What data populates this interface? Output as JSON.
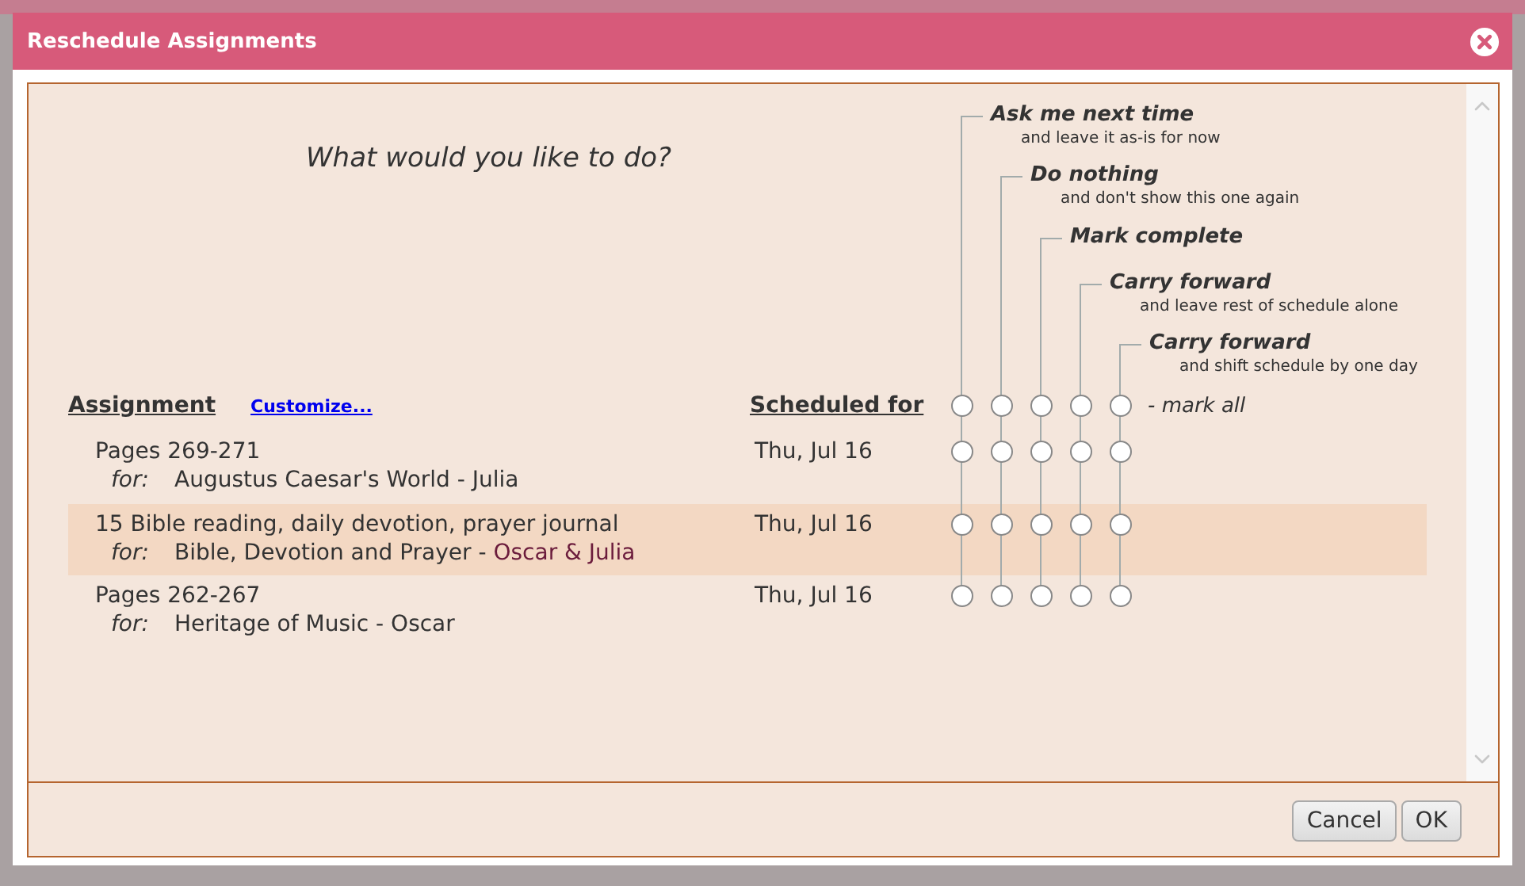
{
  "dialog": {
    "title": "Reschedule Assignments"
  },
  "question": "What would you like to do?",
  "options": [
    {
      "label": "Ask me next time",
      "hint": "and leave it as-is for now"
    },
    {
      "label": "Do nothing",
      "hint": "and don't show this one again"
    },
    {
      "label": "Mark complete"
    },
    {
      "label": "Carry forward",
      "hint": "and leave rest of schedule alone"
    },
    {
      "label": "Carry forward",
      "hint": "and shift schedule by one day"
    }
  ],
  "columns": {
    "assignment": "Assignment",
    "customize": "Customize...",
    "scheduled": "Scheduled for"
  },
  "mark_all": {
    "label": "- mark all",
    "choices": [
      {
        "selected": false
      },
      {
        "selected": false
      },
      {
        "selected": false
      },
      {
        "selected": false
      },
      {
        "selected": false
      }
    ]
  },
  "rows": [
    {
      "title": "Pages 269-271",
      "for_label": "for:",
      "course": "Augustus Caesar's World -",
      "students": "Julia",
      "shared": false,
      "date": "Thu, Jul 16",
      "highlighted": false,
      "choices": [
        {
          "selected": false
        },
        {
          "selected": false
        },
        {
          "selected": false
        },
        {
          "selected": false
        },
        {
          "selected": false
        }
      ]
    },
    {
      "title": "15 Bible reading, daily devotion, prayer journal",
      "for_label": "for:",
      "course": "Bible, Devotion and Prayer -",
      "students": "Oscar & Julia",
      "shared": true,
      "date": "Thu, Jul 16",
      "highlighted": true,
      "choices": [
        {
          "selected": false
        },
        {
          "selected": false
        },
        {
          "selected": false
        },
        {
          "selected": false
        },
        {
          "selected": false
        }
      ]
    },
    {
      "title": "Pages 262-267",
      "for_label": "for:",
      "course": "Heritage of Music -",
      "students": "Oscar",
      "shared": false,
      "date": "Thu, Jul 16",
      "highlighted": false,
      "choices": [
        {
          "selected": false
        },
        {
          "selected": false
        },
        {
          "selected": false
        },
        {
          "selected": false
        },
        {
          "selected": false
        }
      ]
    }
  ],
  "buttons": [
    {
      "label": "Cancel"
    },
    {
      "label": "OK"
    }
  ]
}
